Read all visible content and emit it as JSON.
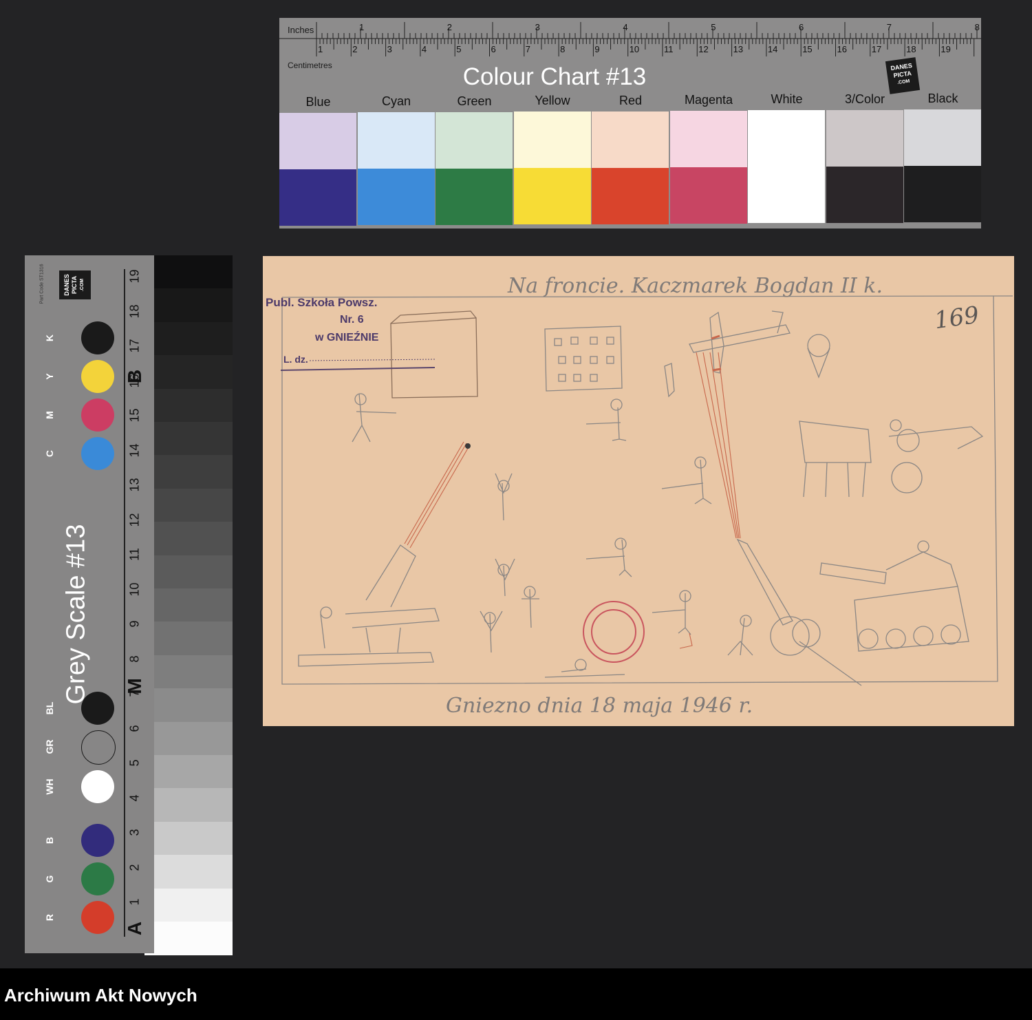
{
  "colour_chart": {
    "title": "Colour Chart #13",
    "inches_label": "Inches",
    "centimetres_label": "Centimetres",
    "inch_numbers": [
      "1",
      "2",
      "3",
      "4",
      "5",
      "6",
      "7",
      "8"
    ],
    "cm_numbers": [
      "1",
      "2",
      "3",
      "4",
      "5",
      "6",
      "7",
      "8",
      "9",
      "10",
      "11",
      "12",
      "13",
      "14",
      "15",
      "16",
      "17",
      "18",
      "19"
    ],
    "logo": [
      "DANES",
      "PICTA",
      ".COM"
    ],
    "patches": [
      {
        "name": "Blue",
        "light": "#d8cce6",
        "dark": "#352e86"
      },
      {
        "name": "Cyan",
        "light": "#d9e8f7",
        "dark": "#3d8bd9"
      },
      {
        "name": "Green",
        "light": "#d3e5d6",
        "dark": "#2d7b45"
      },
      {
        "name": "Yellow",
        "light": "#fdf8d9",
        "dark": "#f7dc35"
      },
      {
        "name": "Red",
        "light": "#f7dac8",
        "dark": "#d9442c"
      },
      {
        "name": "Magenta",
        "light": "#f6d6e2",
        "dark": "#c84563"
      },
      {
        "name": "White",
        "light": "#ffffff",
        "dark": "#ffffff"
      },
      {
        "name": "3/Color",
        "light": "#cdc7c8",
        "dark": "#2b2629"
      },
      {
        "name": "Black",
        "light": "#d8d8db",
        "dark": "#1e1e1f"
      }
    ]
  },
  "grey_scale": {
    "title": "Grey Scale #13",
    "part_code": "Part Code ST1316",
    "logo": [
      "DANES",
      "PICTA",
      ".COM"
    ],
    "numbers": [
      "19",
      "18",
      "17",
      "16",
      "15",
      "14",
      "13",
      "12",
      "11",
      "10",
      "9",
      "8",
      "7",
      "6",
      "5",
      "4",
      "3",
      "2",
      "1"
    ],
    "big_letters": [
      "B",
      "M",
      "A"
    ],
    "dots": [
      {
        "label": "K",
        "color": "#1a1a1a"
      },
      {
        "label": "Y",
        "color": "#f3d33a"
      },
      {
        "label": "M",
        "color": "#cc3d63"
      },
      {
        "label": "C",
        "color": "#3a8ad8"
      },
      {
        "label": "BL",
        "color": "#1a1a1a"
      },
      {
        "label": "GR",
        "color": "#878686"
      },
      {
        "label": "WH",
        "color": "#ffffff"
      },
      {
        "label": "B",
        "color": "#322c7c"
      },
      {
        "label": "G",
        "color": "#2c7a46"
      },
      {
        "label": "R",
        "color": "#d43d2a"
      }
    ],
    "patch_colors": [
      "#0f0f10",
      "#181818",
      "#1e1e1e",
      "#252525",
      "#2d2d2d",
      "#353535",
      "#3e3e3e",
      "#474747",
      "#515151",
      "#5b5b5b",
      "#666666",
      "#727272",
      "#7e7e7e",
      "#8b8b8b",
      "#989898",
      "#a7a7a7",
      "#b7b7b7",
      "#c9c9c9",
      "#dcdcdc",
      "#f0f0f0",
      "#fcfcfc"
    ]
  },
  "drawing": {
    "title_handwritten": "Na froncie. Kaczmarek Bogdan II k.",
    "page_number": "169",
    "stamp": {
      "line1": "Publ. Szkoła Powsz.",
      "line2": "Nr. 6",
      "line3": "w GNIEŹNIE",
      "line4": "L. dz."
    },
    "date_handwritten": "Gniezno dnia 18 maja 1946 r."
  },
  "footer": {
    "title": "Archiwum Akt Nowych"
  }
}
